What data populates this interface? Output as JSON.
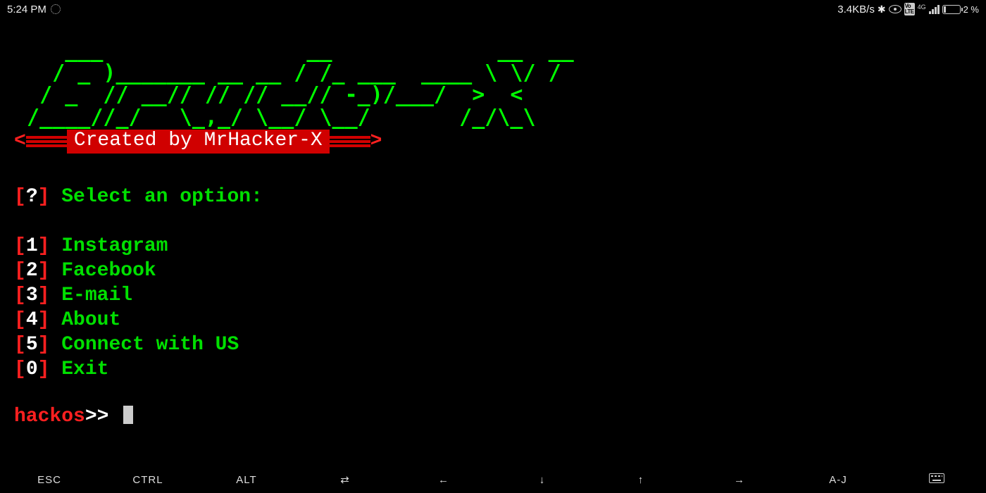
{
  "statusbar": {
    "time": "5:24 PM",
    "net_speed": "3.4KB/s",
    "volte": "Vo\nLTE",
    "net_gen": "4G",
    "battery_pct": "2 %"
  },
  "ascii_art": "    ___                __             __  __\n   / _ )_______ __ __ / /_ ___  ____ \\ \\/ /\n  / _  // __// // // __// -_)/___/  >  < \n /____//_/   \\_,_/ \\__/ \\__/       /_/\\_\\",
  "credit": {
    "left_arrow": "<",
    "label": "Created by MrHacker-X",
    "right_arrow": ">"
  },
  "menu": {
    "prompt_mark": "?",
    "prompt_text": "Select an option:",
    "items": [
      {
        "num": "1",
        "label": "Instagram"
      },
      {
        "num": "2",
        "label": "Facebook"
      },
      {
        "num": "3",
        "label": "E-mail"
      },
      {
        "num": "4",
        "label": "About"
      },
      {
        "num": "5",
        "label": "Connect with US"
      },
      {
        "num": "0",
        "label": "Exit"
      }
    ]
  },
  "prompt": {
    "user": "hackos",
    "symbol": ">> "
  },
  "keyrow": {
    "keys": [
      "ESC",
      "CTRL",
      "ALT",
      "⇄",
      "←",
      "↓",
      "↑",
      "→",
      "A-J"
    ]
  }
}
